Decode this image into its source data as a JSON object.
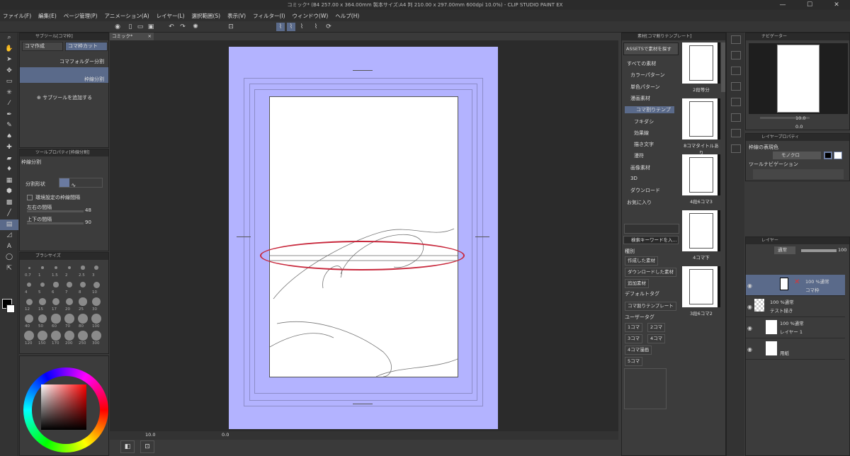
{
  "title": "コミック* (B4 257.00 x 364.00mm 製本サイズ:A4 判 210.00 x 297.00mm 600dpi 10.0%) - CLIP STUDIO PAINT EX",
  "menu": [
    "ファイル(F)",
    "編集(E)",
    "ページ管理(P)",
    "アニメーション(A)",
    "レイヤー(L)",
    "選択範囲(S)",
    "表示(V)",
    "フィルター(I)",
    "ウィンドウ(W)",
    "ヘルプ(H)"
  ],
  "subtool": {
    "header": "サブツール[コマ枠]",
    "tab1": "コマ作成",
    "tab2": "コマ枠カット",
    "item1": "コマフォルダー分割",
    "item2": "枠線分割",
    "add": "サブツールを追加する"
  },
  "toolprop": {
    "header": "ツールプロパティ[枠線分割]",
    "title": "枠線分割",
    "shape": "分割形状",
    "env": "環境設定の枠線間隔",
    "lr": "左右の間隔",
    "lr_val": "48",
    "ud": "上下の間隔",
    "ud_val": "90"
  },
  "brushsize": {
    "header": "ブラシサイズ",
    "sizes": [
      "0.7",
      "1",
      "1.5",
      "2",
      "2.5",
      "3",
      "4",
      "5",
      "6",
      "7",
      "8",
      "10",
      "12",
      "15",
      "17",
      "20",
      "25",
      "30",
      "40",
      "50",
      "60",
      "70",
      "80",
      "100",
      "120",
      "150",
      "170",
      "200",
      "250",
      "300"
    ]
  },
  "canvas": {
    "tab": "コミック*",
    "zoom": "10.0",
    "status_val": "0.0"
  },
  "material": {
    "header": "素材[コマ割りテンプレート]",
    "assets": "ASSETSで素材を探す",
    "tree": [
      "すべての素材",
      "カラーパターン",
      "単色パターン",
      "漫画素材",
      "コマ割りテンプ",
      "フキダシ",
      "効果線",
      "描き文字",
      "漫符",
      "画像素材",
      "3D",
      "ダウンロード",
      "お気に入り"
    ],
    "thumbs": [
      "2段等分",
      "8コマタイトルあり",
      "4段6コマ3",
      "4コマ下",
      "3段6コマ2"
    ],
    "search": "検索キーワードを入...",
    "kind": "種別",
    "kinds": [
      "作成した素材",
      "ダウンロードした素材",
      "追加素材"
    ],
    "default_tag": "デフォルトタグ",
    "default_tag_val": "コマ割りテンプレート",
    "user_tag": "ユーザータグ",
    "tags": [
      "1コマ",
      "2コマ",
      "3コマ",
      "4コマ",
      "4コマ漫画",
      "5コマ"
    ]
  },
  "navigator": {
    "header": "ナビゲーター",
    "zoom": "10.0",
    "rot": "0.0"
  },
  "layerprop": {
    "header": "レイヤープロパティ",
    "border_color": "枠線の表現色",
    "mono": "モノクロ",
    "toolnav": "ツールナビゲーション"
  },
  "layers": {
    "header": "レイヤー",
    "blend": "通常",
    "opacity": "100",
    "items": [
      {
        "line1": "100 %通常",
        "line2": "コマ枠"
      },
      {
        "line1": "100 %通常",
        "line2": "テスト描き"
      },
      {
        "line1": "100 %通常",
        "line2": "レイヤー 1"
      },
      {
        "line1": "",
        "line2": "用紙"
      }
    ]
  },
  "colors": {
    "accent": "#c8283c",
    "canvas_bg": "#b3b3ff",
    "selected": "#5a6a8a"
  }
}
